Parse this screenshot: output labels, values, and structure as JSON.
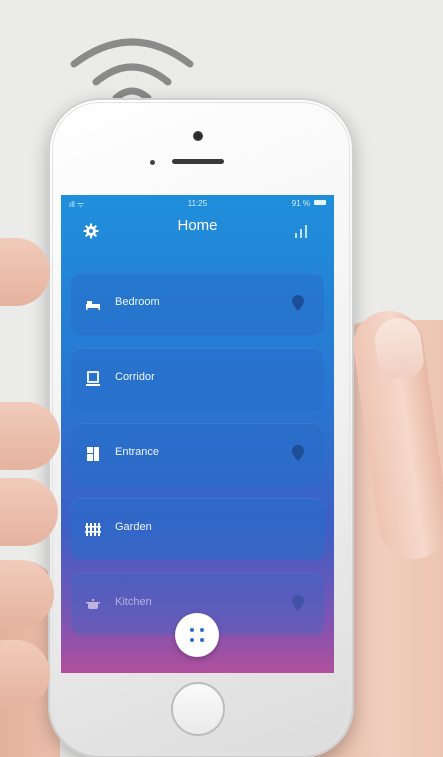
{
  "status_bar": {
    "signal": "ıll ᯤ",
    "time": "11:25",
    "battery": "91 %"
  },
  "header": {
    "title": "Home",
    "settings_icon": "gear-icon",
    "stats_icon": "bar-chart-icon"
  },
  "rooms": [
    {
      "label": "Bedroom",
      "icon": "bed-icon",
      "has_pin": true
    },
    {
      "label": "Corridor",
      "icon": "lamp-icon",
      "has_pin": false
    },
    {
      "label": "Entrance",
      "icon": "door-icon",
      "has_pin": true
    },
    {
      "label": "Garden",
      "icon": "fence-icon",
      "has_pin": false
    },
    {
      "label": "Kitchen",
      "icon": "pot-icon",
      "has_pin": true
    }
  ],
  "fab": {
    "icon": "grid-dots-icon"
  },
  "colors": {
    "screen_top": "#1f8fdb",
    "screen_bottom": "#b04f9c",
    "card": "#2f73cc",
    "pin": "#1d4f99",
    "wifi": "#8a8a8a"
  }
}
